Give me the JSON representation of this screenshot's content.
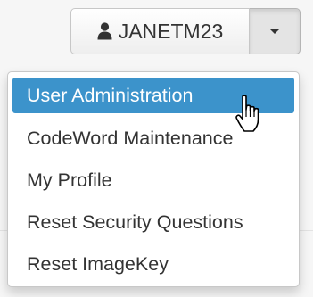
{
  "user_menu": {
    "username": "JANETM23",
    "user_icon": "user-icon",
    "caret_icon": "caret-down-icon",
    "items": [
      {
        "label": "User Administration",
        "active": true
      },
      {
        "label": "CodeWord Maintenance",
        "active": false
      },
      {
        "label": "My Profile",
        "active": false
      },
      {
        "label": "Reset Security Questions",
        "active": false
      },
      {
        "label": "Reset ImageKey",
        "active": false
      }
    ]
  },
  "colors": {
    "highlight": "#3c93cb",
    "text": "#333333",
    "highlight_text": "#ffffff"
  },
  "cursor_icon": "hand-pointer-icon"
}
